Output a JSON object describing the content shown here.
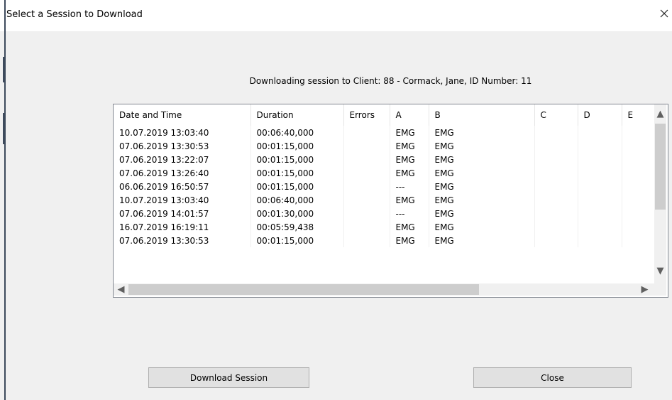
{
  "window": {
    "title": "Select a Session to Download",
    "close_symbol": "✕"
  },
  "status_text": "Downloading session to Client: 88 - Cormack, Jane, ID Number: 11",
  "table": {
    "columns": [
      "Date and Time",
      "Duration",
      "Errors",
      "A",
      "B",
      "C",
      "D",
      "E"
    ],
    "rows": [
      [
        "10.07.2019 13:03:40",
        "00:06:40,000",
        "",
        "EMG",
        "EMG",
        "",
        "",
        ""
      ],
      [
        "07.06.2019 13:30:53",
        "00:01:15,000",
        "",
        "EMG",
        "EMG",
        "",
        "",
        ""
      ],
      [
        "07.06.2019 13:22:07",
        "00:01:15,000",
        "",
        "EMG",
        "EMG",
        "",
        "",
        ""
      ],
      [
        "07.06.2019 13:26:40",
        "00:01:15,000",
        "",
        "EMG",
        "EMG",
        "",
        "",
        ""
      ],
      [
        "06.06.2019 16:50:57",
        "00:01:15,000",
        "",
        "---",
        "EMG",
        "",
        "",
        ""
      ],
      [
        "10.07.2019 13:03:40",
        "00:06:40,000",
        "",
        "EMG",
        "EMG",
        "",
        "",
        ""
      ],
      [
        "07.06.2019 14:01:57",
        "00:01:30,000",
        "",
        "---",
        "EMG",
        "",
        "",
        ""
      ],
      [
        "16.07.2019 16:19:11",
        "00:05:59,438",
        "",
        "EMG",
        "EMG",
        "",
        "",
        ""
      ],
      [
        "07.06.2019 13:30:53",
        "00:01:15,000",
        "",
        "EMG",
        "EMG",
        "",
        "",
        ""
      ]
    ]
  },
  "scrollbar_icons": {
    "up": "▲",
    "down": "▼",
    "left": "◀",
    "right": "▶"
  },
  "buttons": {
    "download": "Download Session",
    "close": "Close"
  }
}
